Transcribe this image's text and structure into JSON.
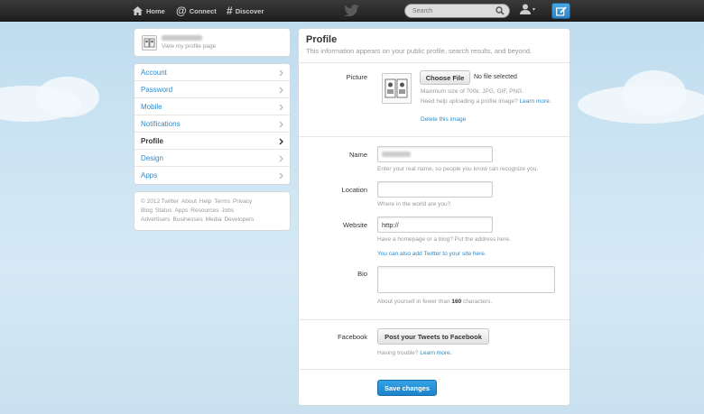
{
  "topbar": {
    "home": "Home",
    "connect": "Connect",
    "discover": "Discover",
    "search_placeholder": "Search"
  },
  "profile_card": {
    "view_link": "View my profile page"
  },
  "settings_nav": {
    "items": [
      {
        "label": "Account"
      },
      {
        "label": "Password"
      },
      {
        "label": "Mobile"
      },
      {
        "label": "Notifications"
      },
      {
        "label": "Profile",
        "active": true
      },
      {
        "label": "Design"
      },
      {
        "label": "Apps"
      }
    ]
  },
  "footer": {
    "links": [
      "© 2012 Twitter",
      "About",
      "Help",
      "Terms",
      "Privacy",
      "Blog",
      "Status",
      "Apps",
      "Resources",
      "Jobs",
      "Advertisers",
      "Businesses",
      "Media",
      "Developers"
    ]
  },
  "main": {
    "title": "Profile",
    "subtitle": "This information appears on your public profile, search results, and beyond.",
    "picture": {
      "label": "Picture",
      "choose_file": "Choose File",
      "no_file": "No file selected",
      "hint": "Maximum size of 700k. JPG, GIF, PNG.",
      "help_prefix": "Need help uploading a profile image?",
      "help_link": "Learn more.",
      "delete": "Delete this image"
    },
    "name": {
      "label": "Name",
      "hint": "Enter your real name, so people you know can recognize you."
    },
    "location": {
      "label": "Location",
      "value": "",
      "hint": "Where in the world are you?"
    },
    "website": {
      "label": "Website",
      "value": "http://",
      "hint": "Have a homepage or a blog? Put the address here.",
      "twitter_link": "You can also add Twitter to your site here."
    },
    "bio": {
      "label": "Bio",
      "hint_prefix": "About yourself in fewer than",
      "hint_count": "160",
      "hint_suffix": "characters."
    },
    "facebook": {
      "label": "Facebook",
      "button": "Post your Tweets to Facebook",
      "trouble": "Having trouble?",
      "learn_more": "Learn more."
    },
    "save_button": "Save changes"
  },
  "colors": {
    "link": "#2e8ac9",
    "button_blue": "#2b8fd6",
    "topbar": "#2a2a2a"
  }
}
